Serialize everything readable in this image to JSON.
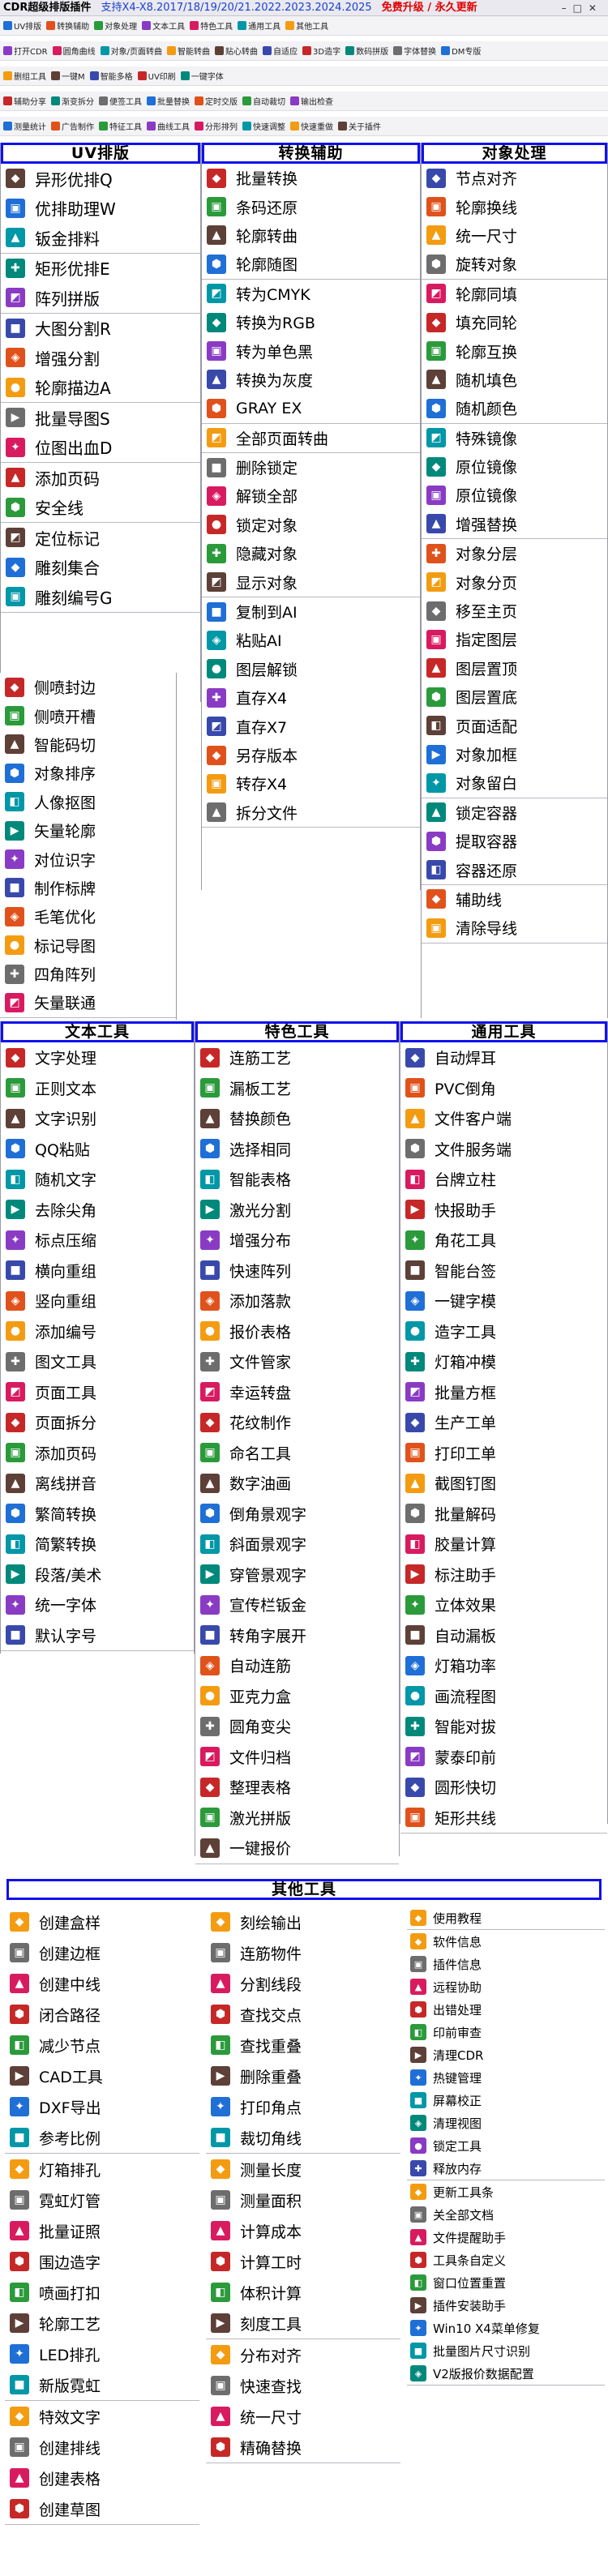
{
  "title": {
    "app": "CDR超级排版插件",
    "versions": "支持X4-X8.2017/18/19/20/21.2022.2023.2024.2025",
    "free": "免费升级 / 永久更新"
  },
  "toolbar_rows": [
    [
      "UV排版",
      "转换辅助",
      "对象处理",
      "文本工具",
      "特色工具",
      "通用工具",
      "其他工具"
    ],
    [
      "打开CDR",
      "圆角曲线",
      "对象/页面转曲",
      "智能转曲",
      "贴心转曲",
      "自适应",
      "3D造字",
      "数码拼版",
      "字体替换",
      "DM专版"
    ],
    [
      "删组工具",
      "一键M",
      "智能多格",
      "UV印刷",
      "一键字体"
    ],
    [
      "辅助分享",
      "渐变拆分",
      "便签工具",
      "批量替换",
      "定时交版",
      "自动裁切",
      "输出检查"
    ],
    [
      "测量统计",
      "广告制作",
      "特征工具",
      "曲线工具",
      "分形排列",
      "快速调整",
      "快速重做",
      "关于插件"
    ]
  ],
  "colors": {
    "accent": "#1010ee",
    "free": "#e00000",
    "ver": "#1a3fd0"
  },
  "uv": {
    "title": "UV排版",
    "items": [
      "异形优排Q",
      "优排助理W",
      "钣金排料",
      "矩形优排E",
      "阵列拼版",
      "大图分割R",
      "增强分割",
      "轮廓描边A",
      "批量导图S",
      "位图出血D",
      "添加页码",
      "安全线",
      "定位标记",
      "雕刻集合",
      "雕刻编号G"
    ]
  },
  "conv": {
    "title": "转换辅助",
    "items": [
      "批量转换",
      "条码还原",
      "轮廓转曲",
      "轮廓随图",
      "转为CMYK",
      "转换为RGB",
      "转为单色黑",
      "转换为灰度",
      "GRAY EX",
      "全部页面转曲",
      "删除锁定",
      "解锁全部",
      "锁定对象",
      "隐藏对象",
      "显示对象",
      "复制到AI",
      "粘贴AI",
      "图层解锁",
      "直存X4",
      "直存X7",
      "另存版本",
      "转存X4",
      "拆分文件"
    ]
  },
  "obj": {
    "title": "对象处理",
    "items": [
      "节点对齐",
      "轮廓换线",
      "统一尺寸",
      "旋转对象",
      "轮廓同填",
      "填充同轮",
      "轮廓互换",
      "随机填色",
      "随机颜色",
      "特殊镜像",
      "原位镜像",
      "原位镜像",
      "增强替换",
      "对象分层",
      "对象分页",
      "移至主页",
      "指定图层",
      "图层置顶",
      "图层置底",
      "页面适配",
      "对象加框",
      "对象留白",
      "锁定容器",
      "提取容器",
      "容器还原",
      "辅助线",
      "清除导线"
    ]
  },
  "sides": {
    "items": [
      "侧喷封边",
      "侧喷开槽",
      "智能码切",
      "对象排序",
      "人像抠图",
      "矢量轮廓",
      "对位识字",
      "制作标牌",
      "毛笔优化",
      "标记导图",
      "四角阵列",
      "矢量联通"
    ]
  },
  "text": {
    "title": "文本工具",
    "items": [
      "文字处理",
      "正则文本",
      "文字识别",
      "QQ粘贴",
      "随机文字",
      "去除尖角",
      "标点压缩",
      "横向重组",
      "竖向重组",
      "添加编号",
      "图文工具",
      "页面工具",
      "页面拆分",
      "添加页码",
      "离线拼音",
      "繁简转换",
      "简繁转换",
      "段落/美术",
      "统一字体",
      "默认字号"
    ]
  },
  "feat": {
    "title": "特色工具",
    "items": [
      "连筋工艺",
      "漏板工艺",
      "替换颜色",
      "选择相同",
      "智能表格",
      "激光分割",
      "增强分布",
      "快速阵列",
      "添加落款",
      "报价表格",
      "文件管家",
      "幸运转盘",
      "花纹制作",
      "命名工具",
      "数字油画",
      "倒角景观字",
      "斜面景观字",
      "穿管景观字",
      "宣传栏钣金",
      "转角字展开",
      "自动连筋",
      "亚克力盒",
      "圆角变尖",
      "文件归档",
      "整理表格",
      "激光拼版",
      "一键报价"
    ]
  },
  "gen": {
    "title": "通用工具",
    "items": [
      "自动焊耳",
      "PVC倒角",
      "文件客户端",
      "文件服务端",
      "台牌立柱",
      "快报助手",
      "角花工具",
      "智能台签",
      "一键字模",
      "造字工具",
      "灯箱冲模",
      "批量方框",
      "生产工单",
      "打印工单",
      "截图钉图",
      "批量解码",
      "胶量计算",
      "标注助手",
      "立体效果",
      "自动漏板",
      "灯箱功率",
      "画流程图",
      "智能对拔",
      "蒙泰印前",
      "圆形快切",
      "矩形共线"
    ]
  },
  "other": {
    "title": "其他工具",
    "col1a": [
      "创建盒样",
      "创建边框",
      "创建中线",
      "闭合路径",
      "减少节点",
      "CAD工具",
      "DXF导出",
      "参考比例"
    ],
    "col1b": [
      "灯箱排孔",
      "霓虹灯管",
      "批量证照",
      "围边造字",
      "喷画打扣",
      "轮廓工艺",
      "LED排孔",
      "新版霓虹"
    ],
    "col1c": [
      "特效文字",
      "创建排线",
      "创建表格",
      "创建草图"
    ],
    "col2a": [
      "刻绘输出",
      "连筋物件",
      "分割线段",
      "查找交点",
      "查找重叠",
      "删除重叠",
      "打印角点",
      "裁切角线"
    ],
    "col2b": [
      "测量长度",
      "测量面积",
      "计算成本",
      "计算工时",
      "体积计算",
      "刻度工具"
    ],
    "col2c": [
      "分布对齐",
      "快速查找",
      "统一尺寸",
      "精确替换"
    ],
    "col3a": [
      "使用教程"
    ],
    "col3b": [
      "软件信息",
      "插件信息",
      "远程协助",
      "出错处理",
      "印前审查",
      "清理CDR",
      "热键管理",
      "屏幕校正",
      "清理视图",
      "锁定工具",
      "释放内存"
    ],
    "col3c": [
      "更新工具条",
      "关全部文档",
      "文件提醒助手",
      "工具条自定义",
      "窗口位置重置",
      "插件安装助手",
      "Win10 X4菜单修复",
      "批量图片尺寸识别",
      "V2版报价数据配置"
    ]
  }
}
